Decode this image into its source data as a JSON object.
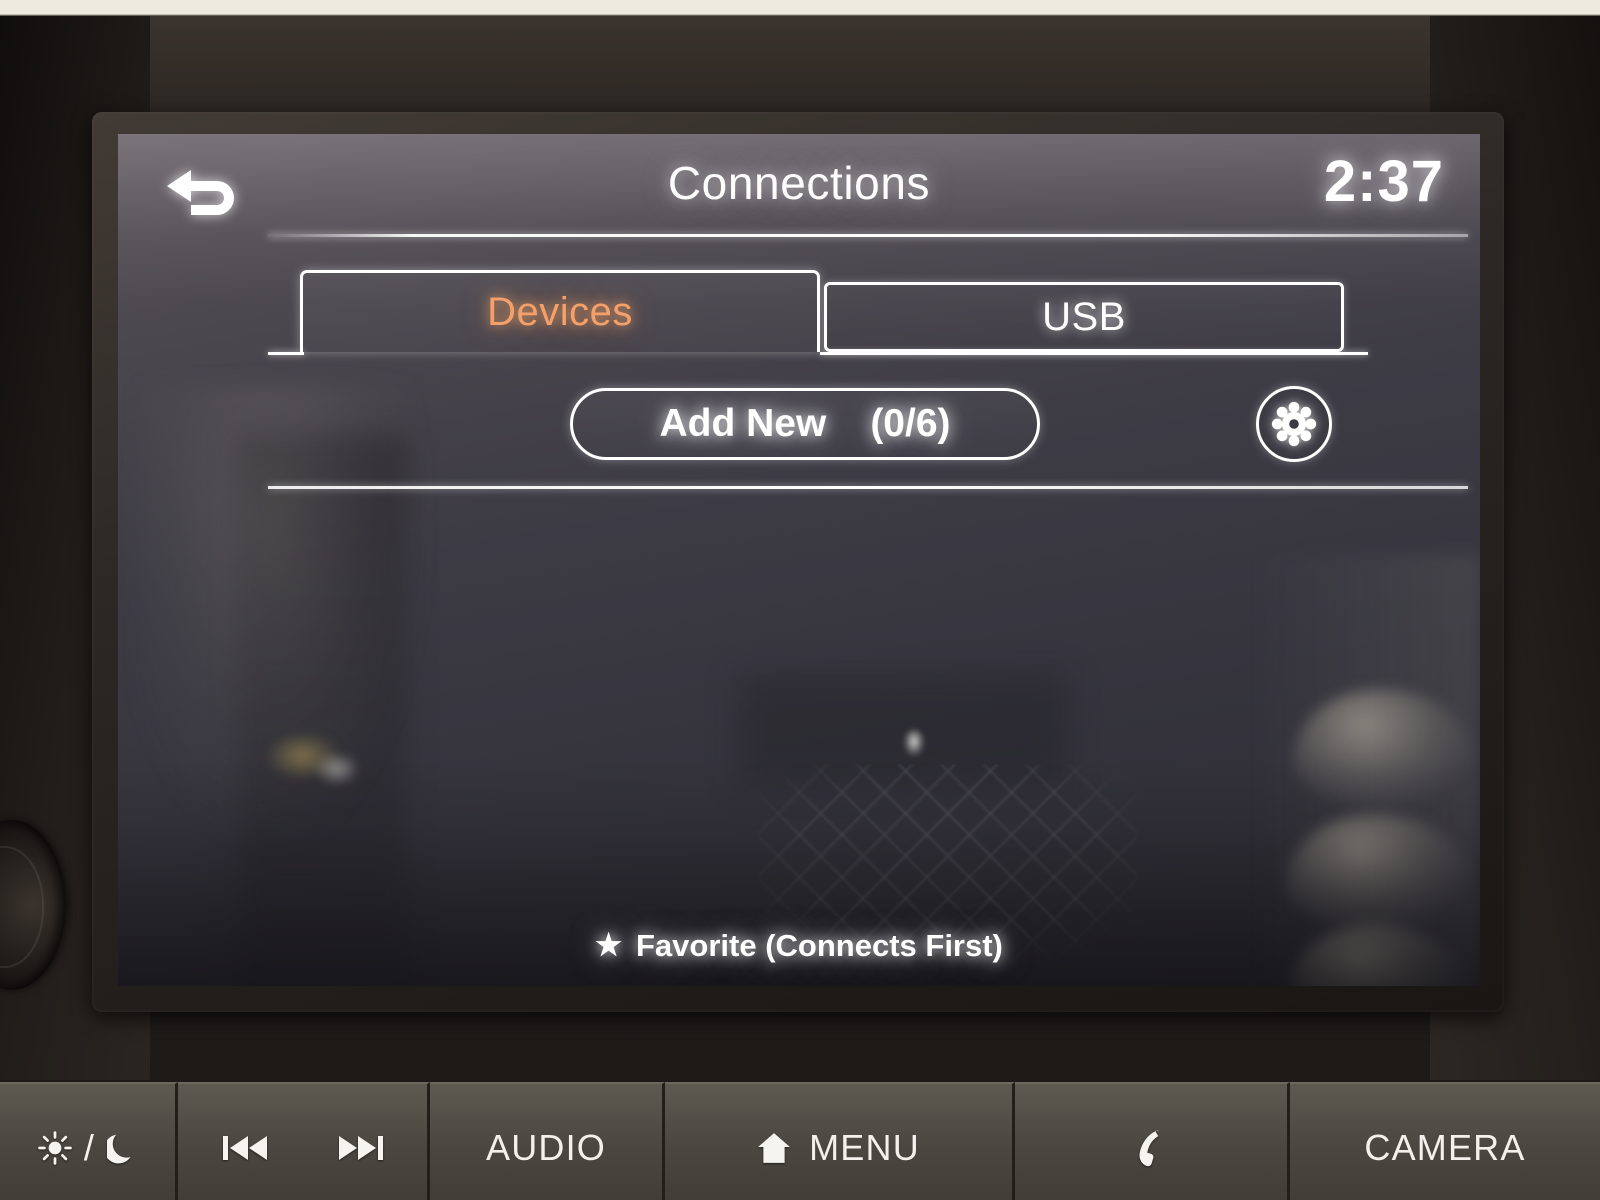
{
  "screen": {
    "header": {
      "back_icon": "back-arrow-icon",
      "title": "Connections",
      "clock": "2:37"
    },
    "tabs": [
      {
        "label": "Devices",
        "active": true,
        "accent": "#f3a06a"
      },
      {
        "label": "USB",
        "active": false,
        "accent": "#ffffff"
      }
    ],
    "toolbar": {
      "add_new_label": "Add New",
      "add_new_count": "(0/6)",
      "settings_icon": "gear-icon"
    },
    "device_list": [],
    "footer": {
      "star_glyph": "★",
      "note": "Favorite (Connects First)"
    }
  },
  "hardware_buttons": [
    {
      "id": "day-night",
      "label": "",
      "icons": [
        "sun-icon",
        "slash",
        "moon-icon"
      ]
    },
    {
      "id": "media",
      "label": "",
      "icons": [
        "previous-track-icon",
        "next-track-icon"
      ]
    },
    {
      "id": "audio",
      "label": "AUDIO",
      "icons": []
    },
    {
      "id": "menu",
      "label": "MENU",
      "icons": [
        "home-icon"
      ]
    },
    {
      "id": "phone",
      "label": "",
      "icons": [
        "phone-icon"
      ]
    },
    {
      "id": "camera",
      "label": "CAMERA",
      "icons": []
    }
  ],
  "colors": {
    "accent_active_tab": "#f3a06a",
    "ui_foreground": "#ffffff",
    "lcd_background": "#3d3b44",
    "bezel": "#2c2724",
    "hardware_button": "#4a4740"
  }
}
